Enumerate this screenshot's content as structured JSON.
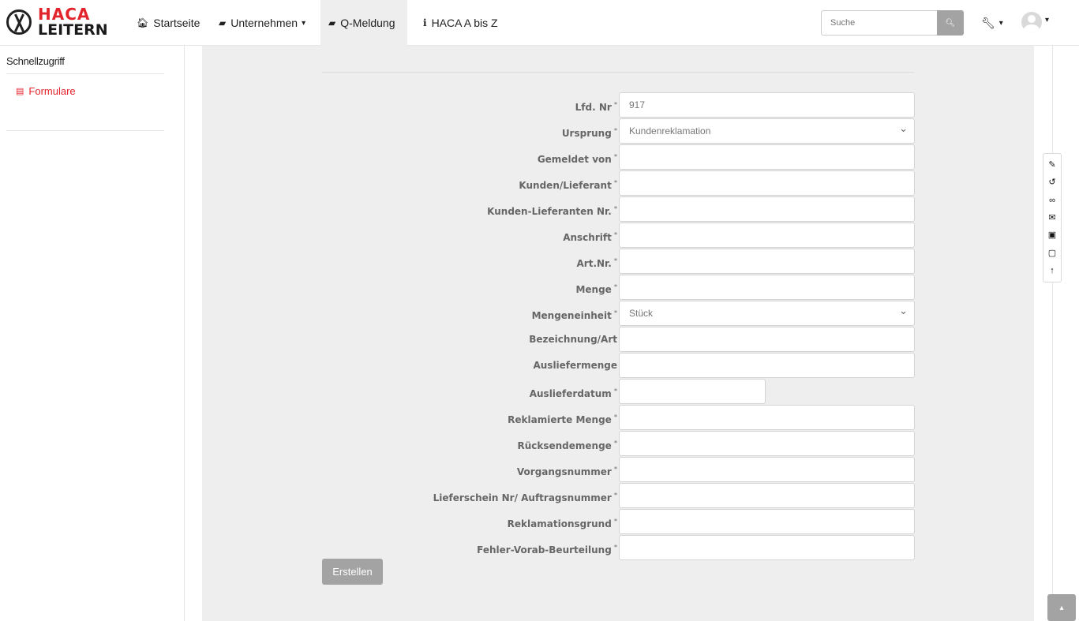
{
  "brand": {
    "line1": "HACA",
    "line2": "LEITERN",
    "accent": "#e3232b"
  },
  "nav": {
    "items": [
      {
        "label": "Startseite",
        "icon": "home-icon",
        "glyph": "🏠︎"
      },
      {
        "label": "Unternehmen",
        "icon": "book-icon",
        "glyph": "▰",
        "caret": "▾"
      },
      {
        "label": "Q-Meldung",
        "icon": "book-icon",
        "glyph": "▰",
        "active": true
      },
      {
        "label": "HACA A bis Z",
        "icon": "info-icon",
        "glyph": "i"
      }
    ],
    "search_placeholder": "Suche",
    "search_icon": "🔍︎",
    "tools_glyph": "🔧︎",
    "caret": "▾"
  },
  "sidebar": {
    "title": "Schnellzugriff",
    "link_label": "Formulare",
    "link_icon": "▤"
  },
  "form": {
    "fields": [
      {
        "label": "Lfd. Nr",
        "required": true,
        "value": "917"
      },
      {
        "label": "Ursprung",
        "required": true,
        "value": "Kundenreklamation",
        "type": "select"
      },
      {
        "label": "Gemeldet von",
        "required": true,
        "value": ""
      },
      {
        "label": "Kunden/Lieferant",
        "required": true,
        "value": ""
      },
      {
        "label": "Kunden-Lieferanten Nr.",
        "required": true,
        "value": ""
      },
      {
        "label": "Anschrift",
        "required": true,
        "value": ""
      },
      {
        "label": "Art.Nr.",
        "required": true,
        "value": ""
      },
      {
        "label": "Menge",
        "required": true,
        "value": ""
      },
      {
        "label": "Mengeneinheit",
        "required": true,
        "value": "Stück",
        "type": "select"
      },
      {
        "label": "Bezeichnung/Art",
        "required": false,
        "value": ""
      },
      {
        "label": "Ausliefermenge",
        "required": false,
        "value": ""
      },
      {
        "label": "Auslieferdatum",
        "required": true,
        "value": "",
        "type": "date"
      },
      {
        "label": "Reklamierte Menge",
        "required": true,
        "value": ""
      },
      {
        "label": "Rücksendemenge",
        "required": true,
        "value": ""
      },
      {
        "label": "Vorgangsnummer",
        "required": true,
        "value": ""
      },
      {
        "label": "Lieferschein Nr/ Auftragsnummer",
        "required": true,
        "value": ""
      },
      {
        "label": "Reklamationsgrund",
        "required": true,
        "value": ""
      },
      {
        "label": "Fehler-Vorab-Beurteilung",
        "required": true,
        "value": ""
      }
    ],
    "required_mark": "*",
    "submit_label": "Erstellen"
  },
  "floatbar": [
    {
      "name": "edit-icon",
      "glyph": "✎"
    },
    {
      "name": "history-icon",
      "glyph": "↺"
    },
    {
      "name": "link-icon",
      "glyph": "∞"
    },
    {
      "name": "mail-icon",
      "glyph": "✉"
    },
    {
      "name": "pdf-icon",
      "glyph": "▣"
    },
    {
      "name": "page-icon",
      "glyph": "▢"
    },
    {
      "name": "arrow-up-icon",
      "glyph": "↑"
    }
  ],
  "scroll_top_glyph": "▴"
}
